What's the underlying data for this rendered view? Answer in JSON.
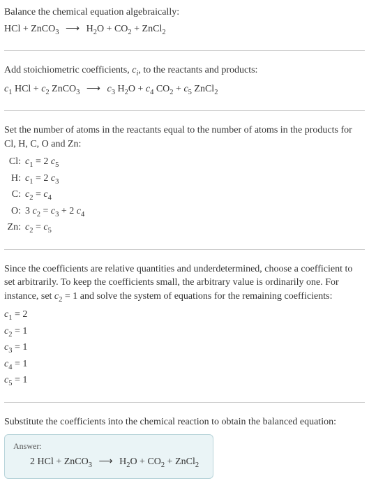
{
  "chart_data": {
    "type": "table",
    "title": "Balance the chemical equation algebraically: HCl + ZnCO3 → H2O + CO2 + ZnCl2",
    "unbalanced_equation": "HCl + ZnCO3 ⟶ H2O + CO2 + ZnCl2",
    "coefficient_equation": "c1 HCl + c2 ZnCO3 ⟶ c3 H2O + c4 CO2 + c5 ZnCl2",
    "atom_constraints": [
      {
        "element": "Cl",
        "equation": "c1 = 2 c5"
      },
      {
        "element": "H",
        "equation": "c1 = 2 c3"
      },
      {
        "element": "C",
        "equation": "c2 = c4"
      },
      {
        "element": "O",
        "equation": "3 c2 = c3 + 2 c4"
      },
      {
        "element": "Zn",
        "equation": "c2 = c5"
      }
    ],
    "arbitrary_choice": "c2 = 1",
    "solution": {
      "c1": 2,
      "c2": 1,
      "c3": 1,
      "c4": 1,
      "c5": 1
    },
    "balanced_equation": "2 HCl + ZnCO3 ⟶ H2O + CO2 + ZnCl2"
  },
  "s1": {
    "line1": "Balance the chemical equation algebraically:"
  },
  "s2": {
    "line1_a": "Add stoichiometric coefficients, ",
    "line1_b": ", to the reactants and products:"
  },
  "s3": {
    "line1": "Set the number of atoms in the reactants equal to the number of atoms in the products for Cl, H, C, O and Zn:",
    "rows": [
      {
        "label": "Cl:"
      },
      {
        "label": "H:"
      },
      {
        "label": "C:"
      },
      {
        "label": "O:"
      },
      {
        "label": "Zn:"
      }
    ]
  },
  "s4": {
    "line1_a": "Since the coefficients are relative quantities and underdetermined, choose a coefficient to set arbitrarily. To keep the coefficients small, the arbitrary value is ordinarily one. For instance, set ",
    "line1_b": " and solve the system of equations for the remaining coefficients:"
  },
  "s5": {
    "line1": "Substitute the coefficients into the chemical reaction to obtain the balanced equation:",
    "answer_label": "Answer:"
  }
}
